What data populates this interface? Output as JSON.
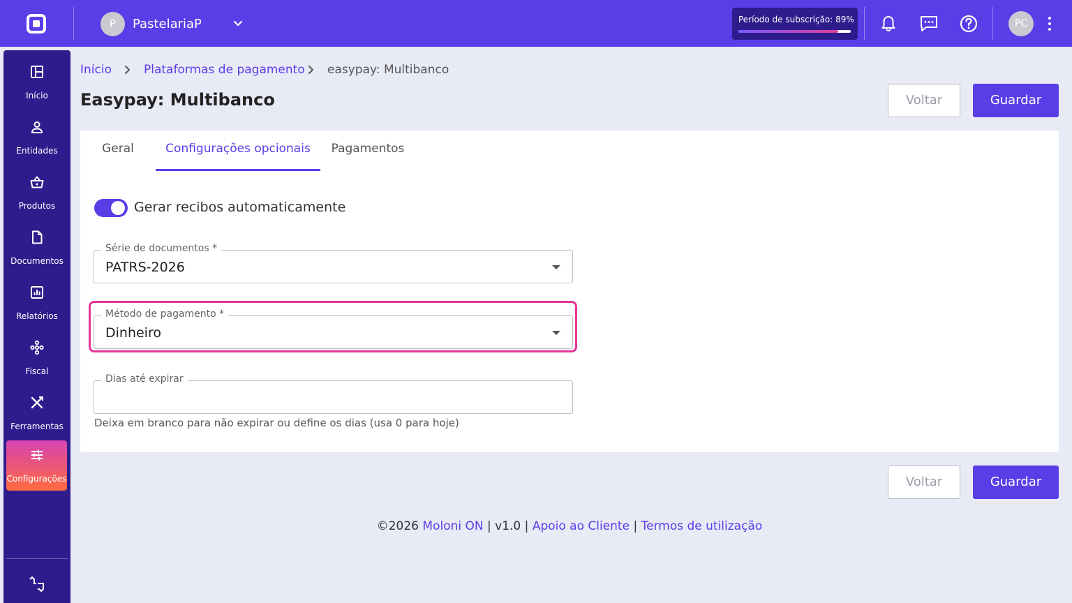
{
  "topbar": {
    "company_initial": "P",
    "company_name": "PastelariaP",
    "subscription_label": "Período de subscrição: 89%",
    "subscription_progress": 0.89,
    "user_initials": "PC"
  },
  "sidebar": {
    "items": [
      {
        "label": "Início",
        "icon": "layout-icon"
      },
      {
        "label": "Entidades",
        "icon": "person-icon"
      },
      {
        "label": "Produtos",
        "icon": "basket-icon"
      },
      {
        "label": "Documentos",
        "icon": "document-icon"
      },
      {
        "label": "Relatórios",
        "icon": "chart-icon"
      },
      {
        "label": "Fiscal",
        "icon": "network-icon"
      },
      {
        "label": "Ferramentas",
        "icon": "tools-icon"
      },
      {
        "label": "Configurações",
        "icon": "sliders-icon",
        "active": true
      }
    ],
    "bottom_icon": "feedback-icon"
  },
  "breadcrumb": {
    "home": "Início",
    "parent": "Plataformas de pagamento",
    "current": "easypay: Multibanco"
  },
  "page": {
    "title": "Easypay: Multibanco",
    "back_label": "Voltar",
    "save_label": "Guardar"
  },
  "tabs": [
    {
      "label": "Geral"
    },
    {
      "label": "Configurações opcionais",
      "active": true
    },
    {
      "label": "Pagamentos"
    }
  ],
  "form": {
    "auto_receipts_label": "Gerar recibos automaticamente",
    "auto_receipts_on": true,
    "series_label": "Série de documentos *",
    "series_value": "PATRS-2026",
    "payment_method_label": "Método de pagamento *",
    "payment_method_value": "Dinheiro",
    "expire_days_label": "Dias até expirar",
    "expire_days_value": "",
    "expire_days_hint": "Deixa em branco para não expirar ou define os dias (usa 0 para hoje)"
  },
  "footer": {
    "copyright": "©2026",
    "brand": "Moloni ON",
    "sep": "|",
    "version": "v1.0",
    "support": "Apoio ao Cliente",
    "terms": "Termos de utilização"
  },
  "colors": {
    "primary": "#5b3de8",
    "sidebar": "#2e1c8d",
    "highlight": "#e5349a",
    "background": "#e8eaf6"
  }
}
